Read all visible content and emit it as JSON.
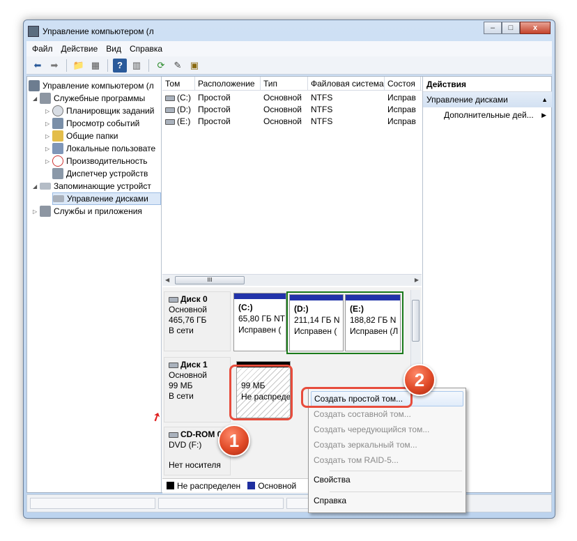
{
  "window": {
    "title": "Управление компьютером (л",
    "btn_min": "–",
    "btn_max": "□",
    "btn_close": "x"
  },
  "menu": [
    "Файл",
    "Действие",
    "Вид",
    "Справка"
  ],
  "tree": [
    {
      "label": "Управление компьютером (л",
      "icon": "computer-icon"
    },
    {
      "label": "Служебные программы",
      "icon": "tools-icon"
    },
    {
      "label": "Планировщик заданий",
      "icon": "clock-icon"
    },
    {
      "label": "Просмотр событий",
      "icon": "event-viewer-icon"
    },
    {
      "label": "Общие папки",
      "icon": "shared-folder-icon"
    },
    {
      "label": "Локальные пользовате",
      "icon": "users-icon"
    },
    {
      "label": "Производительность",
      "icon": "performance-icon"
    },
    {
      "label": "Диспетчер устройств",
      "icon": "device-manager-icon"
    },
    {
      "label": "Запоминающие устройст",
      "icon": "storage-icon"
    },
    {
      "label": "Управление дисками",
      "icon": "disk-management-icon"
    },
    {
      "label": "Службы и приложения",
      "icon": "services-icon"
    }
  ],
  "volumes": {
    "columns": [
      "Том",
      "Расположение",
      "Тип",
      "Файловая система",
      "Состоя"
    ],
    "rows": [
      {
        "name": "(C:)",
        "layout": "Простой",
        "type": "Основной",
        "fs": "NTFS",
        "status": "Исправ"
      },
      {
        "name": "(D:)",
        "layout": "Простой",
        "type": "Основной",
        "fs": "NTFS",
        "status": "Исправ"
      },
      {
        "name": "(E:)",
        "layout": "Простой",
        "type": "Основной",
        "fs": "NTFS",
        "status": "Исправ"
      }
    ],
    "scroll_label": "III"
  },
  "disks": {
    "disk0": {
      "name": "Диск 0",
      "type": "Основной",
      "size": "465,76 ГБ",
      "state": "В сети"
    },
    "disk1": {
      "name": "Диск 1",
      "type": "Основной",
      "size": "99 МБ",
      "state": "В сети"
    },
    "cdrom": {
      "name": "CD-ROM 0",
      "type": "DVD (F:)",
      "state": "Нет носителя"
    },
    "partC": {
      "name": "(C:)",
      "size": "65,80 ГБ NT",
      "status": "Исправен ("
    },
    "partD": {
      "name": "(D:)",
      "size": "211,14 ГБ N",
      "status": "Исправен ("
    },
    "partE": {
      "name": "(E:)",
      "size": "188,82 ГБ N",
      "status": "Исправен (Л"
    },
    "unallocated": {
      "size": "99 МБ",
      "status": "Не распреде"
    }
  },
  "legend": [
    {
      "label": "Не распределен",
      "color": "#000000"
    },
    {
      "label": "Основной",
      "color": "#1f2fa0"
    }
  ],
  "actions": {
    "title": "Действия",
    "section": "Управление дисками",
    "item": "Дополнительные дей..."
  },
  "context_menu": {
    "items": [
      {
        "label": "Создать простой том...",
        "enabled": true
      },
      {
        "label": "Создать составной том...",
        "enabled": false
      },
      {
        "label": "Создать чередующийся том...",
        "enabled": false
      },
      {
        "label": "Создать зеркальный том...",
        "enabled": false
      },
      {
        "label": "Создать том RAID-5...",
        "enabled": false
      },
      {
        "label": "Свойства",
        "enabled": true
      },
      {
        "label": "Справка",
        "enabled": true
      }
    ]
  },
  "annotations": {
    "badge1": "1",
    "badge2": "2"
  },
  "colors": {
    "accent_red": "#e74c3c",
    "primary_partition": "#2233aa",
    "selected_partition_border": "#1a7a1a"
  }
}
